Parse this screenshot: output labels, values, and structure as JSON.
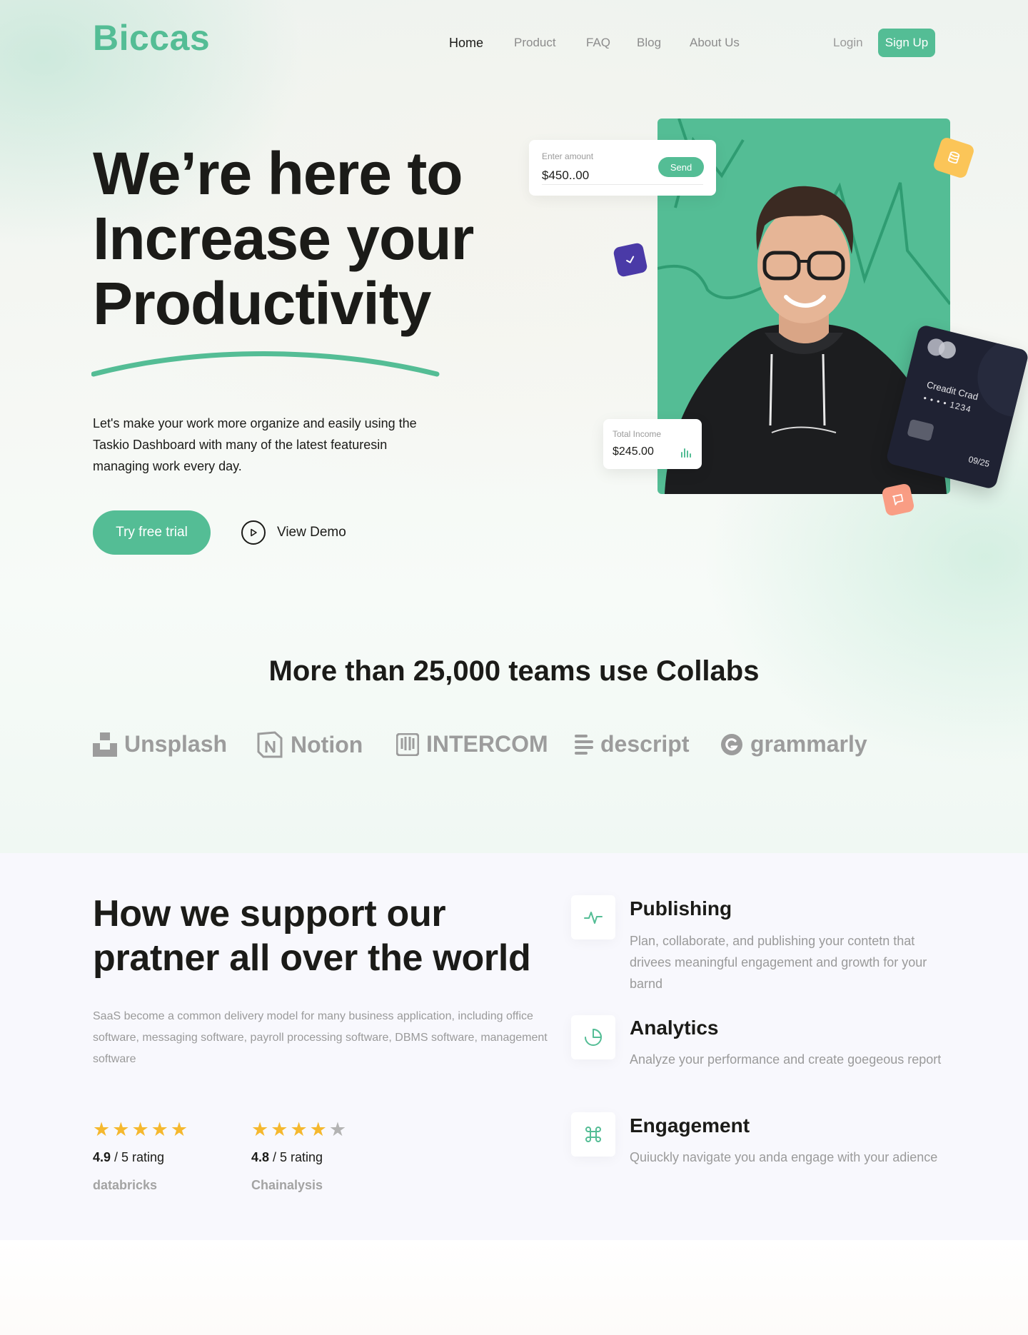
{
  "brand": {
    "logo": "Biccas",
    "accent_color": "#54bd95"
  },
  "nav": {
    "items": [
      {
        "label": "Home",
        "active": true
      },
      {
        "label": "Product",
        "active": false
      },
      {
        "label": "FAQ",
        "active": false
      },
      {
        "label": "Blog",
        "active": false
      },
      {
        "label": "About Us",
        "active": false
      }
    ],
    "login": "Login",
    "signup": "Sign Up"
  },
  "hero": {
    "title_line1": "We’re here to",
    "title_line2": "Increase your",
    "title_line3": "Productivity",
    "description": "Let's make your work more organize and easily using the Taskio Dashboard with many of the latest featuresin managing work every day.",
    "cta_primary": "Try free trial",
    "cta_secondary": "View Demo",
    "amount_card": {
      "label": "Enter amount",
      "value": "$450..00",
      "button": "Send"
    },
    "income_card": {
      "label": "Total Income",
      "value": "$245.00"
    },
    "credit_card": {
      "title": "Creadit Crad",
      "number": "• • • •  1234",
      "expiry": "09/25"
    }
  },
  "teams": {
    "title": "More than 25,000 teams use Collabs",
    "brands": [
      {
        "name": "Unsplash",
        "icon": "unsplash-icon"
      },
      {
        "name": "Notion",
        "icon": "notion-icon"
      },
      {
        "name": "INTERCOM",
        "icon": "intercom-icon"
      },
      {
        "name": "descript",
        "icon": "descript-icon"
      },
      {
        "name": "grammarly",
        "icon": "grammarly-icon"
      }
    ]
  },
  "support": {
    "title_line1": "How we support our",
    "title_line2": "pratner all over the world",
    "description": "SaaS become a common delivery model for many business application, including office software, messaging software, payroll processing software, DBMS software, management software",
    "ratings": [
      {
        "score": "4.9",
        "suffix": " / 5 rating",
        "stars": 5,
        "company": "databricks"
      },
      {
        "score": "4.8",
        "suffix": " / 5 rating",
        "stars": 4,
        "company": "Chainalysis"
      }
    ],
    "features": [
      {
        "title": "Publishing",
        "description": "Plan, collaborate, and publishing your contetn that drivees meaningful engagement and growth for your barnd",
        "icon": "activity-icon"
      },
      {
        "title": "Analytics",
        "description": "Analyze your performance and create goegeous report",
        "icon": "pie-chart-icon"
      },
      {
        "title": "Engagement",
        "description": "Quiuckly navigate you anda engage with your adience",
        "icon": "command-icon"
      }
    ]
  }
}
